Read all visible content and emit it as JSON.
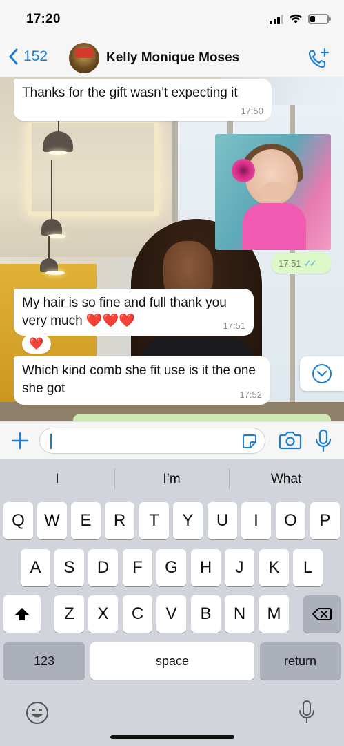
{
  "status": {
    "time": "17:20"
  },
  "header": {
    "back_count": "152",
    "contact_name": "Kelly Monique Moses"
  },
  "messages": [
    {
      "text": "Thanks for the gift wasn’t expecting it",
      "time": "17:50"
    },
    {
      "type": "photo",
      "time": "17:51"
    },
    {
      "text": "My hair is so fine and full thank you very much ❤️❤️❤️",
      "time": "17:51",
      "reaction": "❤️"
    },
    {
      "text": "Which kind comb she fit use is it the one she got",
      "time": "17:52"
    }
  ],
  "composer": {
    "value": ""
  },
  "keyboard": {
    "suggestions": [
      "I",
      "I’m",
      "What"
    ],
    "row1": [
      "Q",
      "W",
      "E",
      "R",
      "T",
      "Y",
      "U",
      "I",
      "O",
      "P"
    ],
    "row2": [
      "A",
      "S",
      "D",
      "F",
      "G",
      "H",
      "J",
      "K",
      "L"
    ],
    "row3": [
      "Z",
      "X",
      "C",
      "V",
      "B",
      "N",
      "M"
    ],
    "numbers_label": "123",
    "space_label": "space",
    "return_label": "return"
  },
  "colors": {
    "accent": "#1a7fd4",
    "outgoing_bubble": "#dcf8c6",
    "read_ticks": "#4aa6e8",
    "heart": "#e1111e"
  }
}
